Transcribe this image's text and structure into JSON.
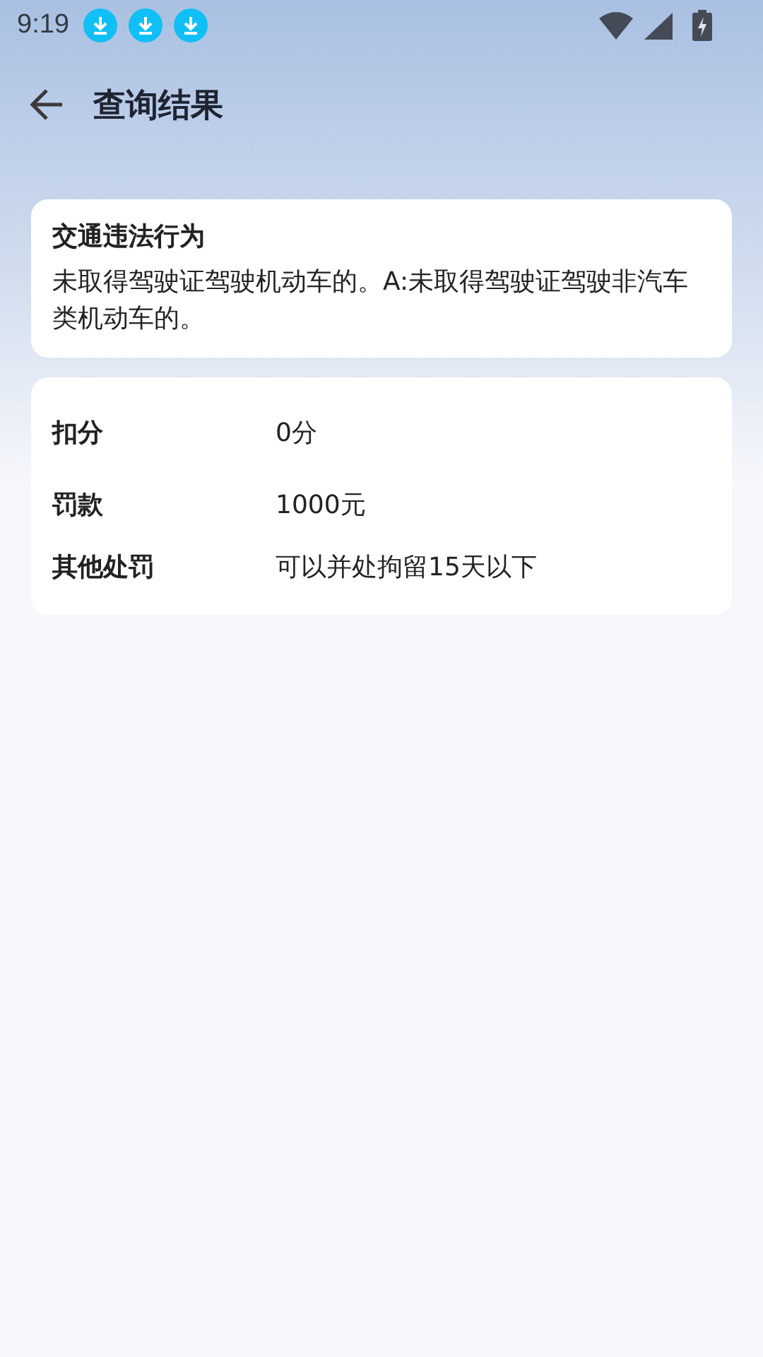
{
  "status_bar": {
    "time": "9:19",
    "notifications": [
      {
        "kind": "download"
      },
      {
        "kind": "download"
      },
      {
        "kind": "download"
      }
    ]
  },
  "header": {
    "title": "查询结果"
  },
  "violation": {
    "title": "交通违法行为",
    "description": "未取得驾驶证驾驶机动车的。A:未取得驾驶证驾驶非汽车类机动车的。"
  },
  "penalties": [
    {
      "label": "扣分",
      "value": "0分"
    },
    {
      "label": "罚款",
      "value": "1000元"
    },
    {
      "label": "其他处罚",
      "value": "可以并处拘留15天以下"
    }
  ]
}
